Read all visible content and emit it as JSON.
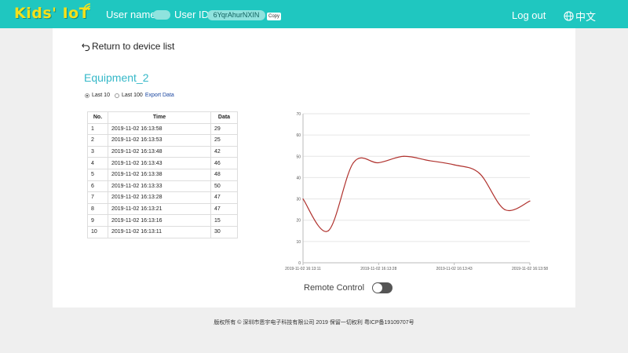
{
  "header": {
    "logo_text": "Kids' IoT",
    "user_name_label": "User name",
    "user_id_label": "User ID",
    "user_id_value": "6YqrAhurNXIN",
    "copy_label": "Copy",
    "logout_label": "Log out",
    "language_label": "中文"
  },
  "page": {
    "back_label": "Return to device list",
    "device_title": "Equipment_2",
    "range_options": [
      "Last 10",
      "Last 100"
    ],
    "selected_range": "Last 10",
    "export_label": "Export Data",
    "remote_control_label": "Remote Control",
    "remote_control_on": false
  },
  "table": {
    "headers": [
      "No.",
      "Time",
      "Data"
    ],
    "rows": [
      [
        "1",
        "2019-11-02 16:13:58",
        "29"
      ],
      [
        "2",
        "2019-11-02 16:13:53",
        "25"
      ],
      [
        "3",
        "2019-11-02 16:13:48",
        "42"
      ],
      [
        "4",
        "2019-11-02 16:13:43",
        "46"
      ],
      [
        "5",
        "2019-11-02 16:13:38",
        "48"
      ],
      [
        "6",
        "2019-11-02 16:13:33",
        "50"
      ],
      [
        "7",
        "2019-11-02 16:13:28",
        "47"
      ],
      [
        "8",
        "2019-11-02 16:13:21",
        "47"
      ],
      [
        "9",
        "2019-11-02 16:13:16",
        "15"
      ],
      [
        "10",
        "2019-11-02 16:13:11",
        "30"
      ]
    ]
  },
  "chart_data": {
    "type": "line",
    "x": [
      "2019-11-02 16:13:11",
      "2019-11-02 16:13:16",
      "2019-11-02 16:13:21",
      "2019-11-02 16:13:28",
      "2019-11-02 16:13:33",
      "2019-11-02 16:13:38",
      "2019-11-02 16:13:43",
      "2019-11-02 16:13:48",
      "2019-11-02 16:13:53",
      "2019-11-02 16:13:58"
    ],
    "x_tick_labels": [
      "2019-11-02 16:13:11",
      "2019-11-02 16:13:28",
      "2019-11-02 16:13:43",
      "2019-11-02 16:13:58"
    ],
    "series": [
      {
        "values": [
          30,
          15,
          47,
          47,
          50,
          48,
          46,
          42,
          25,
          29
        ]
      }
    ],
    "ylim": [
      0,
      70
    ],
    "y_ticks": [
      0,
      10,
      20,
      30,
      40,
      50,
      60,
      70
    ],
    "grid": true,
    "line_color": "#b0322e"
  },
  "footer": {
    "text": "版权所有 © 深圳市恩宇电子科技有限公司 2019 保留一切权利 粤ICP备19109707号"
  },
  "colors": {
    "header_bg": "#1fc7c0",
    "logo": "#f5e01a",
    "title": "#35b8c8",
    "link": "#1a46a0"
  }
}
